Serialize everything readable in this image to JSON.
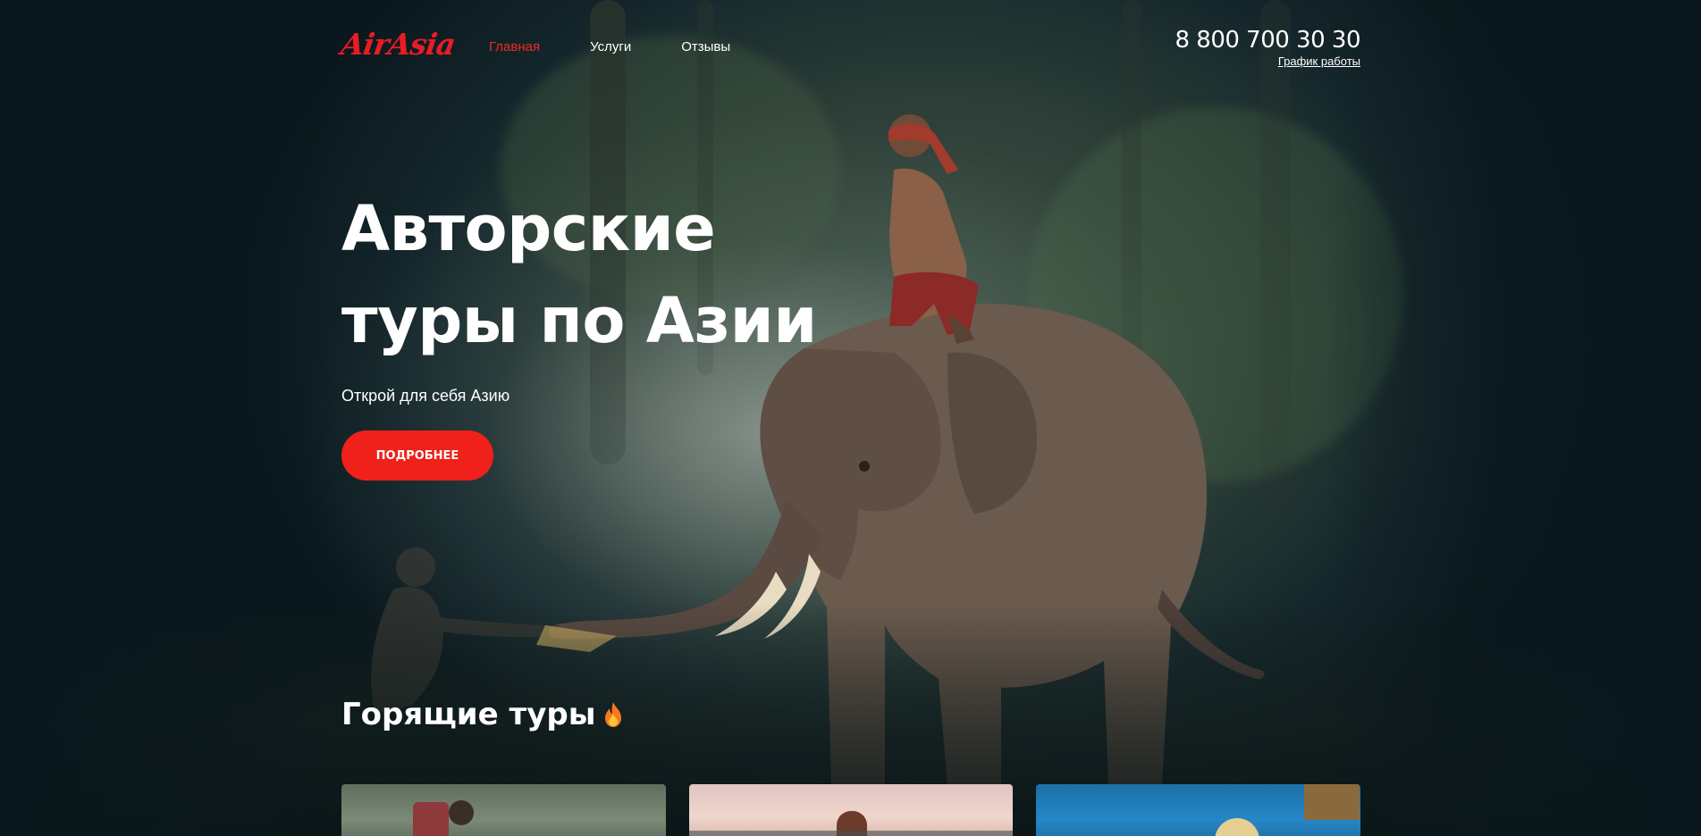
{
  "header": {
    "logo_text": "AirAsia",
    "nav": [
      {
        "label": "Главная",
        "active": true
      },
      {
        "label": "Услуги",
        "active": false
      },
      {
        "label": "Отзывы",
        "active": false
      }
    ],
    "phone": "8 800 700 30 30",
    "schedule_link": "График работы"
  },
  "hero": {
    "title_line1": "Авторские",
    "title_line2": "туры по Азии",
    "subtitle": "Открой для себя Азию",
    "cta_label": "ПОДРОБНЕЕ"
  },
  "hot_tours": {
    "title": "Горящие туры",
    "icon": "fire-icon"
  },
  "colors": {
    "accent": "#f0201a",
    "logo": "#e81c24",
    "background": "#0d1a1e"
  }
}
